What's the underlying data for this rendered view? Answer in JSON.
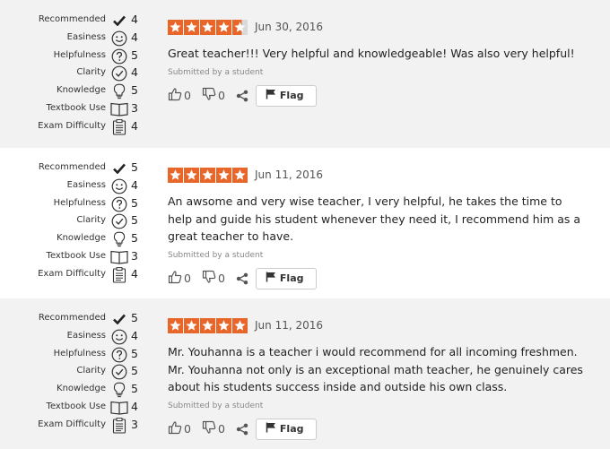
{
  "metric_labels": {
    "recommended": "Recommended",
    "easiness": "Easiness",
    "helpfulness": "Helpfulness",
    "clarity": "Clarity",
    "knowledge": "Knowledge",
    "textbook": "Textbook Use",
    "exam": "Exam Difficulty"
  },
  "icons": {
    "recommended": "checkmark-icon",
    "easiness": "smiley-face-icon",
    "helpfulness": "question-mark-circle-icon",
    "clarity": "check-circle-icon",
    "knowledge": "lightbulb-icon",
    "textbook": "open-book-icon",
    "exam": "clipboard-icon",
    "thumbs_up": "thumbs-up-icon",
    "thumbs_down": "thumbs-down-icon",
    "share": "share-icon",
    "flag": "flag-icon"
  },
  "colors": {
    "star": "#e8662a",
    "star_empty": "#d9d9d9",
    "row_alt_bg": "#f2f2f2"
  },
  "flag_label": "Flag",
  "reviews": [
    {
      "metrics": {
        "recommended": "4",
        "easiness": "4",
        "helpfulness": "5",
        "clarity": "4",
        "knowledge": "5",
        "textbook": "3",
        "exam": "4"
      },
      "rating": 4.5,
      "date": "Jun 30, 2016",
      "comment": "Great teacher!!! Very helpful and knowledgeable! Was also very helpful!",
      "submitted": "Submitted by a student",
      "thumbs_up": "0",
      "thumbs_down": "0"
    },
    {
      "metrics": {
        "recommended": "5",
        "easiness": "4",
        "helpfulness": "5",
        "clarity": "5",
        "knowledge": "5",
        "textbook": "3",
        "exam": "4"
      },
      "rating": 5,
      "date": "Jun 11, 2016",
      "comment": "An awsome and very wise teacher, I very helpful, he takes the time to help and guide his student whenever they need it, I recommend him as a great teacher to have.",
      "submitted": "Submitted by a student",
      "thumbs_up": "0",
      "thumbs_down": "0"
    },
    {
      "metrics": {
        "recommended": "5",
        "easiness": "4",
        "helpfulness": "5",
        "clarity": "5",
        "knowledge": "5",
        "textbook": "4",
        "exam": "3"
      },
      "rating": 5,
      "date": "Jun 11, 2016",
      "comment": "Mr. Youhanna is a teacher i would recommend for all incoming freshmen. Mr. Youhanna not only is an exceptional math teacher, he genuinely cares about his students success inside and outside his own class.",
      "submitted": "Submitted by a student",
      "thumbs_up": "0",
      "thumbs_down": "0"
    }
  ]
}
